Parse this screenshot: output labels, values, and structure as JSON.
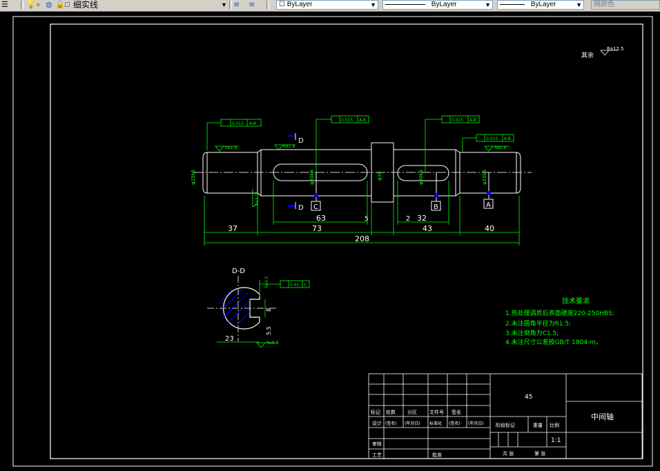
{
  "toolbar": {
    "layer_name": "细实线",
    "color_combo": "ByLayer",
    "linetype_combo": "ByLayer",
    "lineweight_combo": "ByLayer",
    "plotstyle_combo": "随颜色",
    "color_checkbox": "☐"
  },
  "drawing": {
    "overall_roughness_label": "其余",
    "overall_roughness_value": "Ra12.5",
    "roughness": [
      "Ra1.6",
      "Ra1.6",
      "Ra0.8",
      "Ra3.2",
      "Ra3.2",
      "Ra6.3"
    ],
    "gdt": [
      "0.015",
      "A-B",
      "0.015",
      "A-B",
      "0.015",
      "A-B",
      "0.015",
      "A-B",
      "0.01",
      "C"
    ],
    "section_mark": "D",
    "datums": [
      "C",
      "B",
      "A"
    ],
    "diameters": [
      "φ25k6",
      "φ30k6",
      "φ38",
      "φ30k6",
      "φ25k6"
    ],
    "dims_lower": [
      "37",
      "73",
      "5",
      "2",
      "43",
      "40"
    ],
    "dims_upper": [
      "63",
      "32"
    ],
    "overall_length": "208",
    "section_title": "D-D",
    "section_dim_width": "23",
    "section_dim_keyway": "8",
    "section_dim_depth": "5.5",
    "tech_title": "技术要求",
    "tech_notes": [
      "1.热处理调质后表面硬度220-250HBS;",
      "2.未注圆角半径为R1.5;",
      "3.未注倒角为C1.5;",
      "4.未注尺寸公差按GB/T 1804-m。"
    ]
  },
  "title_block": {
    "material": "45",
    "part_name": "中间轴",
    "scale": "1:1",
    "row_labels": [
      "标记",
      "处数",
      "分区",
      "文件号",
      "签名"
    ],
    "design_row": [
      "设计",
      "(签名)",
      "(年月日)",
      "标准化",
      "(签名)",
      "(年月日)"
    ],
    "stage_mark": "阶段标记",
    "weight": "重量",
    "scale_label": "比例",
    "review": "审核",
    "process": "工艺",
    "approve": "批准",
    "sheet_total": "共 张",
    "sheet_num": "第 张"
  }
}
